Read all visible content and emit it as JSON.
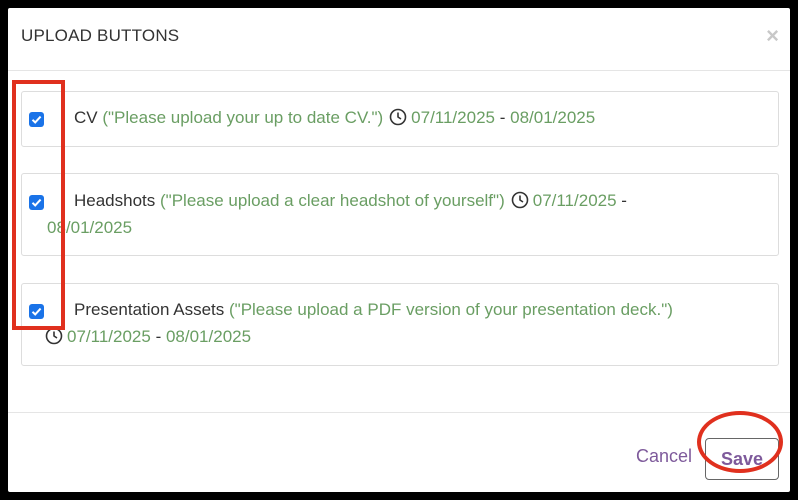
{
  "modal": {
    "title": "UPLOAD BUTTONS",
    "close_symbol": "×"
  },
  "items": [
    {
      "checked": true,
      "name": "CV",
      "description": "(\"Please upload your up to date CV.\")",
      "start": "07/11/2025",
      "separator": "-",
      "end": "08/01/2025"
    },
    {
      "checked": true,
      "name": "Headshots",
      "description": "(\"Please upload a clear headshot of yourself\")",
      "start": "07/11/2025",
      "separator": "-",
      "end": "08/01/2025"
    },
    {
      "checked": true,
      "name": "Presentation Assets",
      "description": "(\"Please upload a PDF version of your presentation deck.\")",
      "start": "07/11/2025",
      "separator": "-",
      "end": "08/01/2025"
    }
  ],
  "footer": {
    "cancel_label": "Cancel",
    "save_label": "Save"
  },
  "colors": {
    "checkbox": "#1a73e8",
    "description": "#6a9e63",
    "action_text": "#7e5a9b",
    "annotation": "#e0301e"
  },
  "icons": {
    "close": "close-icon",
    "clock": "clock-icon",
    "check": "checkmark-icon"
  }
}
